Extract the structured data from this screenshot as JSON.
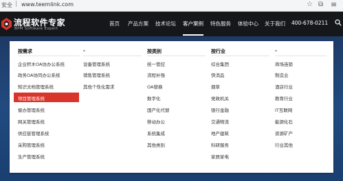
{
  "browser": {
    "security_label": "安全",
    "url": "www.teemlink.com"
  },
  "header": {
    "logo_name": "流程软件专家",
    "logo_sub": "BPM Software Expert",
    "nav": [
      "首页",
      "产品方案",
      "技术论坛",
      "客户案例",
      "特色服务",
      "体验中心",
      "关于我们"
    ],
    "active_nav": "客户案例",
    "phone": "400-678-0211"
  },
  "dropdown": {
    "columns": [
      {
        "head": "按需求",
        "items": [
          "企业积木OA协办公系统",
          "政务OA协同办公系统",
          "知识文档管理系统",
          "项目管理系统",
          "督办管理系统",
          "网关管理系统",
          "供应链管理系统",
          "采购管理系统",
          "生产管理系统"
        ]
      },
      {
        "head": "-",
        "items": [
          "设备管理系统",
          "销售管理系统",
          "其他个性化需求"
        ]
      },
      {
        "head": "按类别",
        "items": [
          "统一管控",
          "流程补强",
          "OA替换",
          "数字化",
          "国产化代替",
          "移动办公",
          "系统集成",
          "其他类别"
        ]
      },
      {
        "head": "按行业",
        "items": [
          "综合集团",
          "快消品",
          "烟草",
          "党政机关",
          "银行金融",
          "交通物流",
          "地产建筑",
          "科研服务",
          "家居家电"
        ]
      },
      {
        "head": "-",
        "items": [
          "商场连锁",
          "制造业",
          "酒店行业",
          "教育行业",
          "IT互联网",
          "能源化石",
          "资源矿产",
          "行业其他"
        ]
      }
    ],
    "highlighted_item": "项目管理系统",
    "highlight_color": "#d9352b"
  }
}
